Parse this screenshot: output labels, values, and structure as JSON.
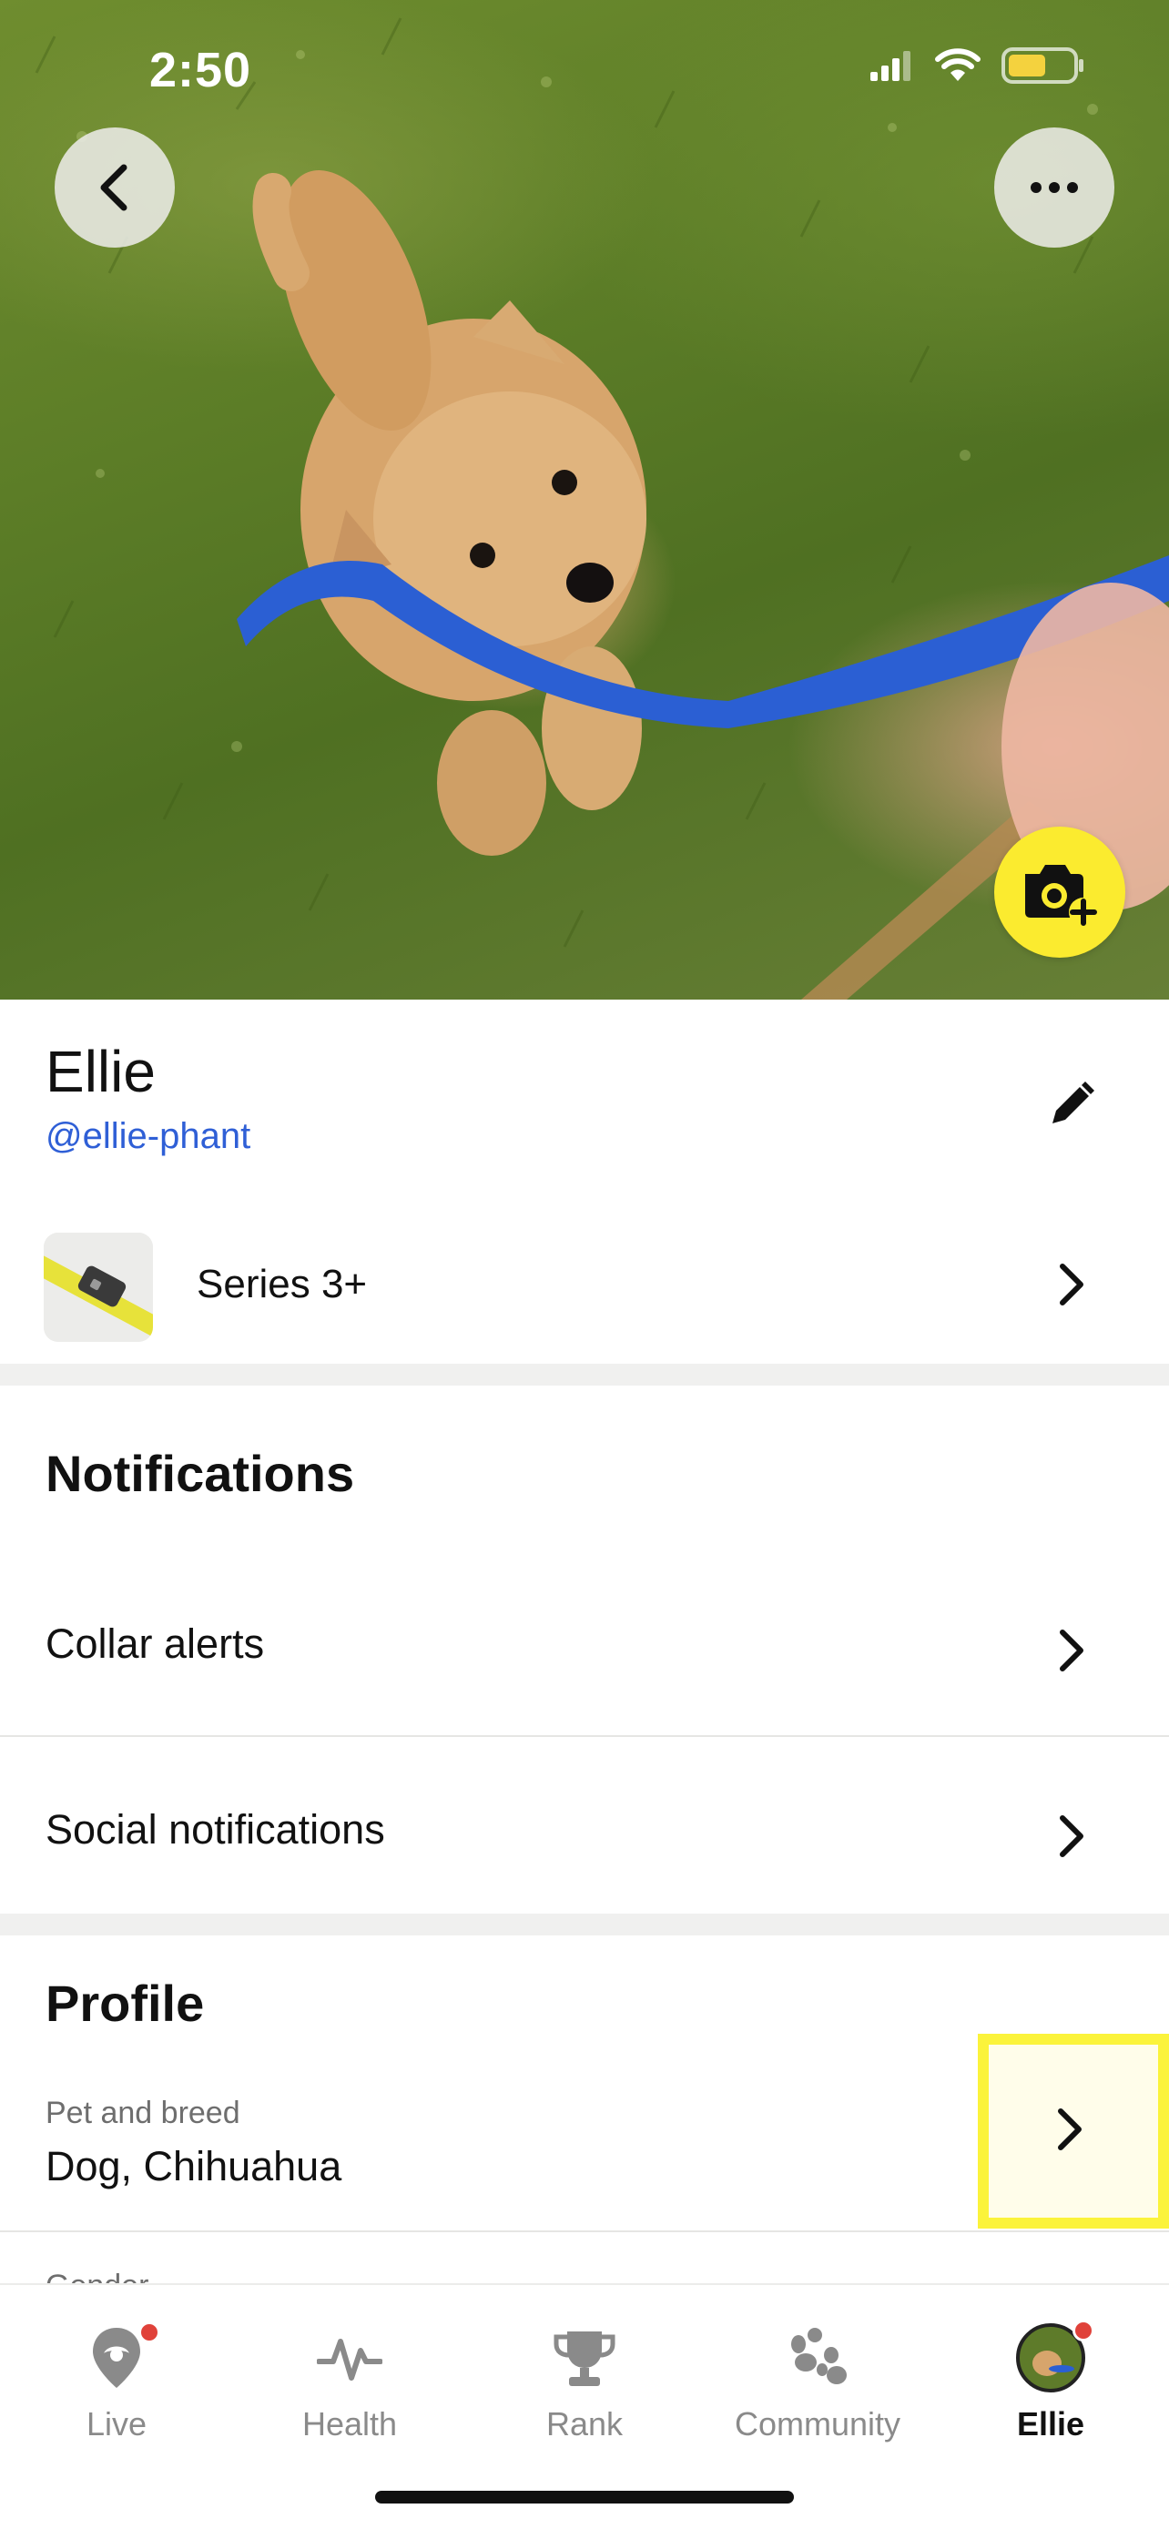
{
  "status_bar": {
    "time": "2:50",
    "icons": [
      "cellular-signal-icon",
      "wifi-icon",
      "battery-icon"
    ]
  },
  "hero": {
    "back_icon": "chevron-left-icon",
    "more_icon": "ellipsis-icon",
    "camera_icon": "camera-add-icon",
    "camera_button_color": "#fbeb2f"
  },
  "profile": {
    "name": "Ellie",
    "handle": "@ellie-phant",
    "edit_icon": "pencil-icon"
  },
  "device": {
    "label": "Series 3+",
    "thumbnail_icon": "collar-icon"
  },
  "notifications": {
    "title": "Notifications",
    "items": [
      {
        "label": "Collar alerts"
      },
      {
        "label": "Social notifications"
      }
    ]
  },
  "profile_section": {
    "title": "Profile",
    "pet_and_breed_label": "Pet and breed",
    "pet_and_breed_value": "Dog, Chihuahua",
    "next_field_label": "Gender"
  },
  "tabbar": {
    "tabs": [
      {
        "label": "Live",
        "icon": "location-pin-icon",
        "badge": true
      },
      {
        "label": "Health",
        "icon": "pulse-icon",
        "badge": false
      },
      {
        "label": "Rank",
        "icon": "trophy-icon",
        "badge": false
      },
      {
        "label": "Community",
        "icon": "paw-icon",
        "badge": false
      },
      {
        "label": "Ellie",
        "icon": "pet-avatar-icon",
        "badge": true,
        "active": true
      }
    ]
  },
  "colors": {
    "link": "#2f5fd6",
    "highlight": "#fbf33b",
    "badge": "#e0423a"
  }
}
